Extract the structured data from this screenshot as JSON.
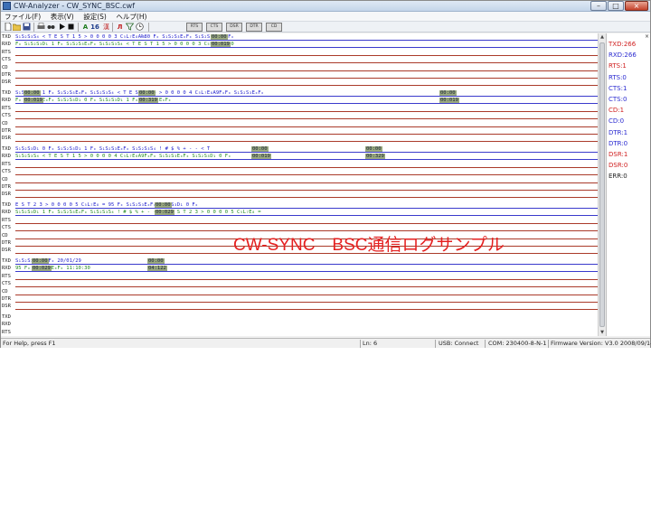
{
  "window": {
    "title": "CW-Analyzer - CW_SYNC_BSC.cwf",
    "min": "–",
    "max": "□",
    "close": "×"
  },
  "menu": [
    "ファイル(F)",
    "表示(V)",
    "設定(S)",
    "ヘルプ(H)"
  ],
  "toolbar": {
    "icons": [
      "new-file-icon",
      "open-folder-icon",
      "save-icon",
      "print-icon",
      "find-icon",
      "play-icon",
      "stop-icon",
      "ascii-icon",
      "hex-icon",
      "font-icon",
      "pulse-icon",
      "filter-icon",
      "clock-icon"
    ],
    "ascii_label": "A",
    "hex_label": "16",
    "font_label": "漢",
    "pulse_label": "Л",
    "signal_buttons": [
      "RTS",
      "CTS",
      "DSR",
      "DTR",
      "CD"
    ]
  },
  "signals": [
    "TXD",
    "RXD",
    "RTS",
    "CTS",
    "CD",
    "DTR",
    "DSR"
  ],
  "blocks": [
    {
      "tx": "S₁S₂S₃S₄ < T E S T 1 5 > 0 0 0 0 3 C₅L₇E₈A₨80 Fₓ          S₁S₂S₃EₓFₓ            S₁S₂S₃D₁ 0 Fₓ",
      "rx": "Fₓ                                        S₁S₂S₃D₁ 1 Fₓ           S₁S₂S₃EₓFₓ           S₁S₂S₃S₄ < T E S T 1 5 > 0 0 0 0 3 C₅L₇E₈A₨80",
      "stamps": [
        {
          "t": "00:00",
          "row": "tx",
          "cls": "s1"
        },
        {
          "t": "00:019",
          "row": "rx",
          "cls": "s2"
        }
      ]
    },
    {
      "tx": "     S₁S₂S₃D₁ 1 Fₓ           S₁S₂S₃EₓFₓ            S₁S₂S₃S₄ < T E S T 1 5 > 0 0 0 0 4 C₅L₇E₈A9FₓFₓ           S₁S₂S₃EₓFₓ",
      "rx": "Fₓ       S₁S₂S₃EₓFₓ              S₁S₂S₃D₁ 0 Fₓ                                            S₁S₂S₃D₁ 1 Fₓ          S₁S₂S₃EₓFₓ",
      "stamps": [
        {
          "t": "00:00",
          "row": "tx",
          "cls": "s3"
        },
        {
          "t": "00:019",
          "row": "rx",
          "cls": "s4"
        },
        {
          "t": "00:00",
          "row": "tx",
          "cls": "s5"
        },
        {
          "t": "00:319",
          "row": "rx",
          "cls": "s6"
        },
        {
          "t": "00:00",
          "row": "tx",
          "cls": "s7"
        },
        {
          "t": "00:019",
          "row": "rx",
          "cls": "s8"
        }
      ]
    },
    {
      "tx": "S₁S₂S₃D₁ 0 Fₓ                                                    S₁S₂S₃D₁ 1 Fₓ          S₁S₂S₃EₓFₓ       S₁S₂S₃S₄ ! # $ % + - - < T",
      "rx": "         S₁S₂S₃S₄ < T E S T 1 5 > 0 0 0 0 4 C₅L₇E₈A9FₓFₓ          S₁S₂S₃EₓFₓ          S₁S₂S₃D₁ 0 Fₓ",
      "stamps": [
        {
          "t": "00:00",
          "row": "tx",
          "cls": "s9"
        },
        {
          "t": "00:019",
          "row": "rx",
          "cls": "s10"
        },
        {
          "t": "00:00",
          "row": "tx",
          "cls": "s11"
        },
        {
          "t": "00:329",
          "row": "rx",
          "cls": "s12"
        }
      ]
    },
    {
      "tx": "E S T 2 3 > 0 0 0 0 5 C₅L₇E₈ = 95 Fₓ              S₁S₂S₃EₓFₓ              S₁S₂S₃D₁ 0 Fₓ",
      "rx": "                                       S₁S₂S₃D₁ 1 Fₓ        S₁S₂S₃EₓFₓ            S₁S₂S₃S₄ ! # $ % + - - < T E S T 2 3 > 0 0 0 0 5 C₅L₇E₈ =",
      "stamps": [
        {
          "t": "00:00",
          "row": "tx",
          "cls": "s13"
        },
        {
          "t": "00:029",
          "row": "rx",
          "cls": "s14"
        }
      ]
    },
    {
      "tx": "      S₁S₂S₃D₁ 1 Fₓ                       20/01/29",
      "rx": "95 Fₓ            S₁S₂S₃EₓFₓ                  11:10:30",
      "stamps": [
        {
          "t": "00:00",
          "row": "tx",
          "cls": "s15"
        },
        {
          "t": "00:029",
          "row": "rx",
          "cls": "s16"
        },
        {
          "t": "00:00",
          "row": "tx",
          "cls": "s17"
        },
        {
          "t": "04:122",
          "row": "rx",
          "cls": "s18"
        }
      ]
    }
  ],
  "caption": "CW-SYNC　BSC通信ログサンプル",
  "status_panel": [
    {
      "text": "TXD:266",
      "color": "#d02020"
    },
    {
      "text": "RXD:266",
      "color": "#2a2ad0"
    },
    {
      "text": "RTS:1",
      "color": "#d02020"
    },
    {
      "text": "RTS:0",
      "color": "#2a2ad0"
    },
    {
      "text": "CTS:1",
      "color": "#2a2ad0"
    },
    {
      "text": "CTS:0",
      "color": "#2a2ad0"
    },
    {
      "text": "CD:1",
      "color": "#d02020"
    },
    {
      "text": "CD:0",
      "color": "#2a2ad0"
    },
    {
      "text": "DTR:1",
      "color": "#2a2ad0"
    },
    {
      "text": "DTR:0",
      "color": "#2a2ad0"
    },
    {
      "text": "DSR:1",
      "color": "#d02020"
    },
    {
      "text": "DSR:0",
      "color": "#d02020"
    },
    {
      "text": "ERR:0",
      "color": "#222222"
    }
  ],
  "statusbar": {
    "help": "For Help, press F1",
    "line": "Ln: 6",
    "usb": "USB: Connect",
    "com": "COM: 230400-8-N-1",
    "firmware": "Firmware Version: V3.0 2008/09/14"
  }
}
